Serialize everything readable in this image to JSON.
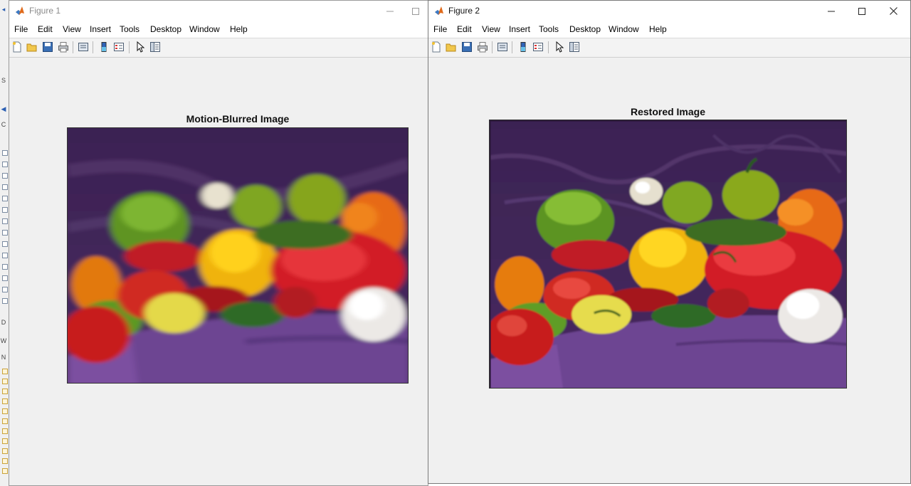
{
  "figure1": {
    "title": "Figure 1",
    "menu": [
      "File",
      "Edit",
      "View",
      "Insert",
      "Tools",
      "Desktop",
      "Window",
      "Help"
    ],
    "axes_title": "Motion-Blurred Image",
    "image_state": "blurred"
  },
  "figure2": {
    "title": "Figure 2",
    "menu": [
      "File",
      "Edit",
      "View",
      "Insert",
      "Tools",
      "Desktop",
      "Window",
      "Help"
    ],
    "axes_title": "Restored Image",
    "image_state": "sharp"
  },
  "toolbar_icons": [
    "new-figure-icon",
    "open-file-icon",
    "save-icon",
    "print-icon",
    "link-plot-icon",
    "insert-colorbar-icon",
    "insert-legend-icon",
    "edit-plot-icon",
    "property-inspector-icon"
  ],
  "window_controls": [
    "minimize-icon",
    "maximize-icon",
    "close-icon"
  ],
  "colors": {
    "figure_bg": "#f0f0f0",
    "titlebar_bg": "#ffffff",
    "backdrop_purple": "#3d2350",
    "cloth_purple": "#6a4290"
  }
}
